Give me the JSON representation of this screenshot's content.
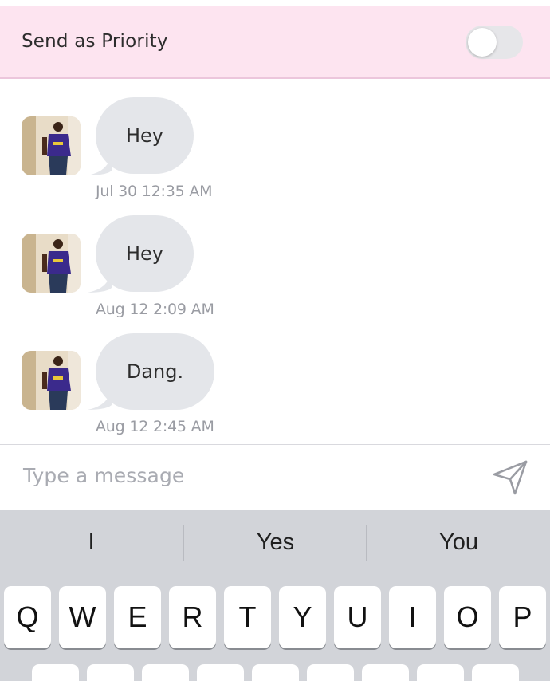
{
  "priority": {
    "label": "Send as Priority",
    "toggle_on": false
  },
  "messages": [
    {
      "text": "Hey",
      "timestamp": "Jul 30 12:35 AM"
    },
    {
      "text": "Hey",
      "timestamp": "Aug 12 2:09 AM"
    },
    {
      "text": "Dang.",
      "timestamp": "Aug 12 2:45 AM"
    }
  ],
  "composer": {
    "placeholder": "Type a message",
    "send_icon": "send-paper-plane-icon"
  },
  "keyboard": {
    "suggestions": [
      "I",
      "Yes",
      "You"
    ],
    "row1": [
      "Q",
      "W",
      "E",
      "R",
      "T",
      "Y",
      "U",
      "I",
      "O",
      "P"
    ]
  },
  "colors": {
    "priority_bg": "#fde4f0",
    "bubble_bg": "#e4e6ea",
    "keyboard_bg": "#d2d4d9"
  }
}
